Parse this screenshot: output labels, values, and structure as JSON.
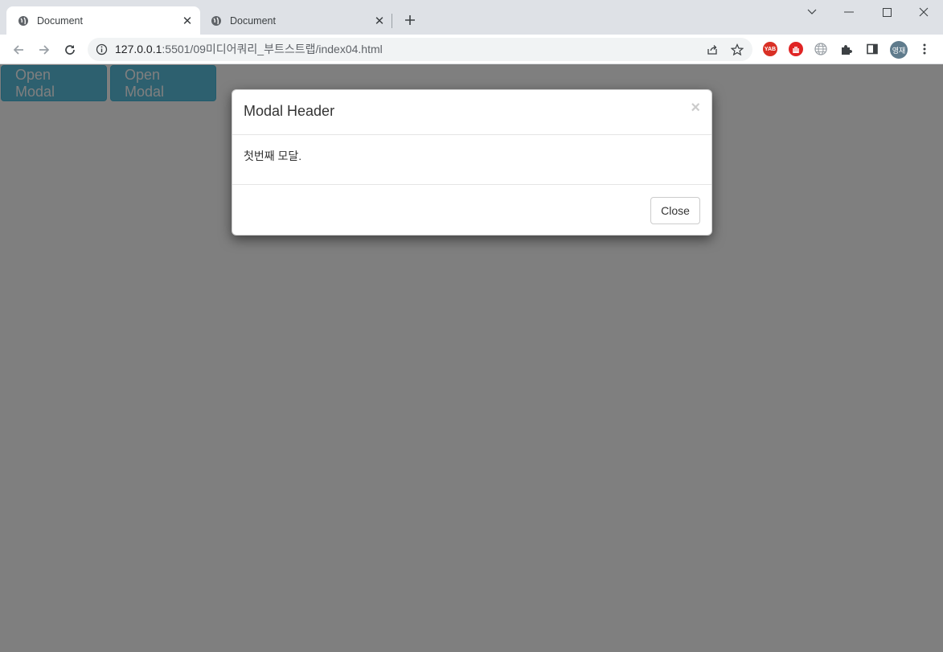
{
  "browser": {
    "tabs": [
      {
        "title": "Document",
        "active": true
      },
      {
        "title": "Document",
        "active": false
      }
    ],
    "address": {
      "host": "127.0.0.1",
      "path": ":5501/09미디어쿼리_부트스트랩/index04.html"
    },
    "extensions": {
      "yab_label": "YAB"
    },
    "profile": {
      "initials": "영재"
    }
  },
  "page": {
    "buttons": [
      {
        "label": "Open Modal"
      },
      {
        "label": "Open Modal"
      }
    ],
    "button_color": "#5bc0de",
    "backdrop_opacity": 0.5
  },
  "modal": {
    "header": "Modal Header",
    "close_symbol": "×",
    "body": "첫번째 모달.",
    "footer_button": "Close"
  }
}
